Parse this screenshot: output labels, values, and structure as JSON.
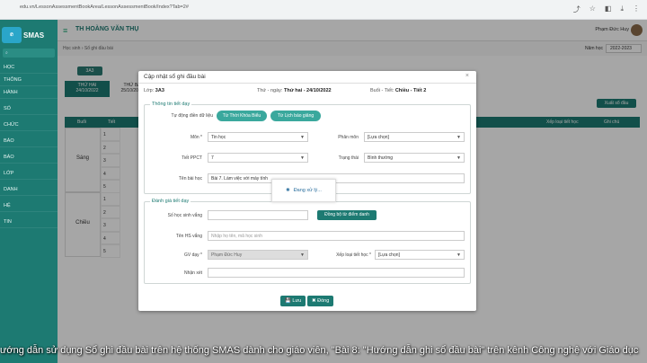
{
  "browser": {
    "url": "edu.vn/LessonAssessmentBookArea/LessonAssessmentBook/Index?Tab=2#"
  },
  "app": {
    "logo_text": "SMAS",
    "teacher": "TH HOÀNG VĂN THỤ",
    "user": "Phạm Đức Huy",
    "year_label": "Năm học",
    "year_value": "2022-2023"
  },
  "sidebar": {
    "items": [
      "HỌC",
      "THÔNG",
      "HÀNH",
      "SỔ",
      "CHỨC",
      "BÁO",
      "BÁO",
      "LỚP",
      "DANH",
      "HỆ",
      "TIN"
    ]
  },
  "breadcrumb": {
    "a": "Học sinh",
    "b": "Sổ ghi đầu bài"
  },
  "page": {
    "class_btn": "3A3",
    "day1": "THỨ HAI",
    "date1": "24/10/2022",
    "day2": "THỨ BA",
    "date2": "25/10/2022",
    "export": "Xuất sổ đầu",
    "col_session": "Buổi",
    "col_period": "Tiết",
    "col_type": "Xếp loại tiết học",
    "col_note": "Ghi chú",
    "morning": "Sáng",
    "afternoon": "Chiều",
    "nums": [
      "1",
      "2",
      "3",
      "4",
      "5",
      "1",
      "2",
      "3",
      "4",
      "5"
    ]
  },
  "modal": {
    "title": "Cập nhật sổ ghi đầu bài",
    "close": "×",
    "class_label": "Lớp",
    "class_value": "3A3",
    "date_label": "Thứ - ngày:",
    "date_value": "Thứ hai - 24/10/2022",
    "session_label": "Buổi - Tiết:",
    "session_value": "Chiều - Tiết 2",
    "sec1": "Thông tin tiết dạy",
    "auto_label": "Tự động điền dữ liệu",
    "btn_tkb": "Từ Thời Khóa Biểu",
    "btn_lbg": "Từ Lịch báo giảng",
    "subject_label": "Môn *",
    "subject_value": "Tin học",
    "part_label": "Phân môn",
    "part_value": "[Lựa chọn]",
    "ppct_label": "Tiết PPCT",
    "ppct_value": "7",
    "status_label": "Trạng thái",
    "status_value": "Bình thường",
    "lesson_label": "Tên bài học",
    "lesson_value": "Bài 7. Làm việc với máy tính",
    "sec2": "Đánh giá tiết dạy",
    "absent_label": "Số học sinh vắng",
    "sync_btn": "Đồng bộ từ điểm danh",
    "absent_names_label": "Tên HS vắng",
    "absent_names_placeholder": "Nhập họ tên, mã học sinh",
    "gv_label": "GV dạy *",
    "gv_value": "Phạm Đức Huy",
    "rating_label": "Xếp loại tiết học *",
    "rating_value": "[Lựa chọn]",
    "note_label": "Nhận xét",
    "loading": "Đang xử lý...",
    "save": "Lưu",
    "close_btn": "Đóng"
  },
  "caption": "ướng dẫn sử dụng Sổ ghi đầu bài trên hệ thống SMAS dành cho giáo viên, \"Bài 8: \"Hướng dẫn ghi sổ đầu bài\" trên kênh Công nghệ với Giáo dục"
}
